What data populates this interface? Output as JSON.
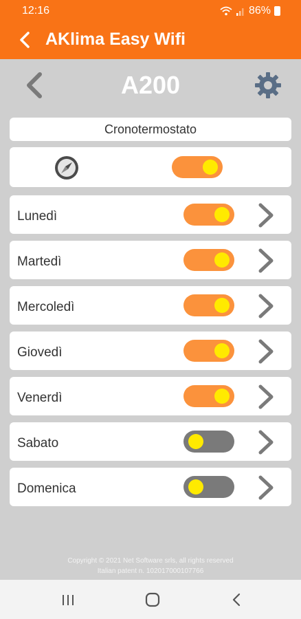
{
  "status": {
    "time": "12:16",
    "battery": "86%"
  },
  "appbar": {
    "title": "AKlima Easy Wifi"
  },
  "device": {
    "name": "A200"
  },
  "cronotermostato": {
    "title": "Cronotermostato",
    "master_on": true
  },
  "days": [
    {
      "label": "Lunedì",
      "on": true
    },
    {
      "label": "Martedì",
      "on": true
    },
    {
      "label": "Mercoledì",
      "on": true
    },
    {
      "label": "Giovedì",
      "on": true
    },
    {
      "label": "Venerdì",
      "on": true
    },
    {
      "label": "Sabato",
      "on": false
    },
    {
      "label": "Domenica",
      "on": false
    }
  ],
  "footer": {
    "copyright": "Copyright © 2021 Net Software srls, all rights reserved",
    "patent": "Italian patent n. 102017000107766"
  },
  "colors": {
    "primary": "#f97316",
    "toggle_on": "#fb923c",
    "toggle_off": "#7a7a7a",
    "knob": "#ffea00"
  }
}
